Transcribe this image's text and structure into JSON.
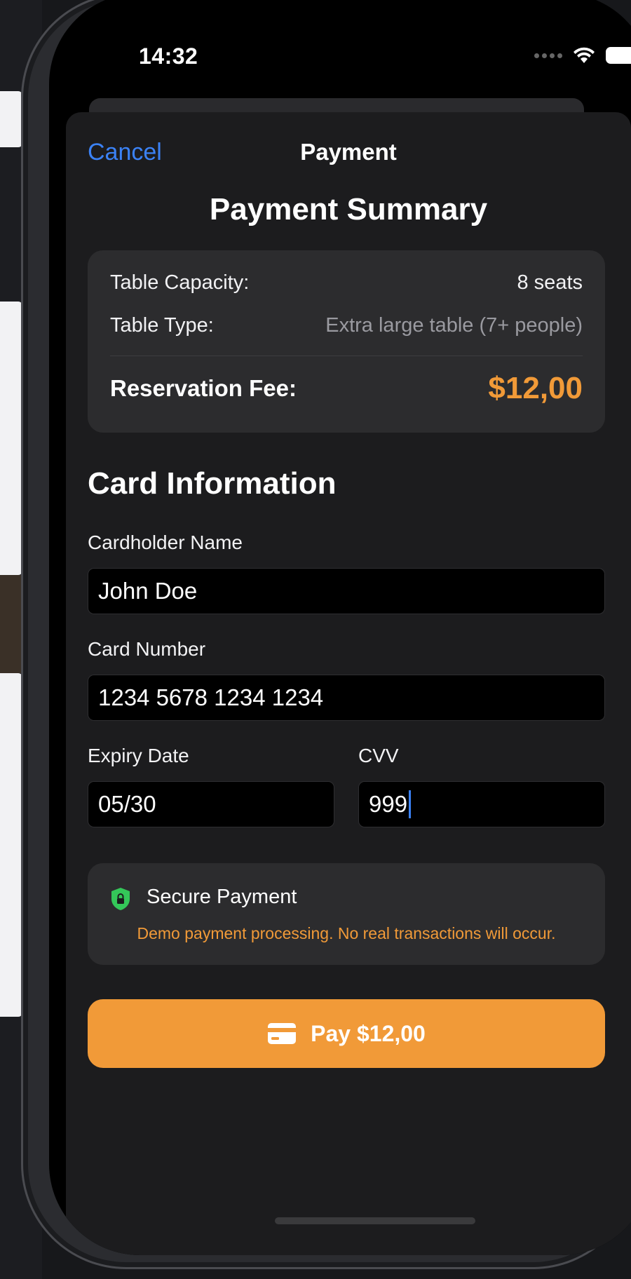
{
  "status_bar": {
    "time": "14:32"
  },
  "nav": {
    "cancel_label": "Cancel",
    "title": "Payment"
  },
  "summary": {
    "heading": "Payment Summary",
    "capacity_label": "Table Capacity:",
    "capacity_value": "8 seats",
    "type_label": "Table Type:",
    "type_value": "Extra large table (7+ people)",
    "fee_label": "Reservation Fee:",
    "fee_value": "$12,00"
  },
  "card_form": {
    "heading": "Card Information",
    "holder_label": "Cardholder Name",
    "holder_value": "John Doe",
    "number_label": "Card Number",
    "number_value": "1234 5678 1234 1234",
    "expiry_label": "Expiry Date",
    "expiry_value": "05/30",
    "cvv_label": "CVV",
    "cvv_value": "999"
  },
  "secure": {
    "title": "Secure Payment",
    "note": "Demo payment processing. No real transactions will occur.",
    "icon": "shield-lock-icon"
  },
  "pay_button": {
    "label": "Pay $12,00",
    "icon": "credit-card-icon"
  },
  "colors": {
    "accent": "#f19a38",
    "link": "#3b82f6",
    "secure_green": "#34c759"
  }
}
